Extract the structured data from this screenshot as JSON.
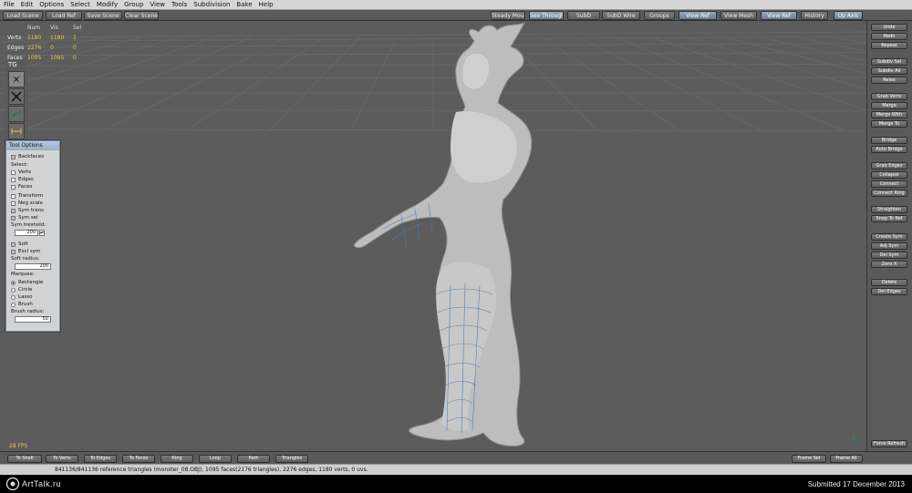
{
  "menu": [
    "File",
    "Edit",
    "Options",
    "Select",
    "Modify",
    "Group",
    "View",
    "Tools",
    "Subdivision",
    "Bake",
    "Help"
  ],
  "toolbar": {
    "left": [
      "Load Scene",
      "Load Ref",
      "Save Scene",
      "Clear Scene"
    ],
    "right": [
      "Steady Mouse",
      "See Through",
      "SubD",
      "SubD Wire",
      "Groups",
      "View Ref",
      "View Mesh",
      "View Ref",
      "History",
      "Up Axis"
    ]
  },
  "stats": {
    "header": [
      "Num",
      "Vis",
      "Sel"
    ],
    "rows": [
      {
        "label": "Verts",
        "num": "1180",
        "vis": "1180",
        "sel": "1"
      },
      {
        "label": "Edges",
        "num": "2276",
        "vis": "0",
        "sel": "0"
      },
      {
        "label": "Faces",
        "num": "1095",
        "vis": "1095",
        "sel": "0"
      }
    ]
  },
  "tool_group": "TG",
  "tool_icons": [
    "move-tool-icon",
    "transform-tool-icon",
    "curve-tool-icon",
    "measure-tool-icon"
  ],
  "tool_options": {
    "title": "Tool Options",
    "backfaces": "Backfaces",
    "select_label": "Select:",
    "verts": "Verts",
    "edges": "Edges",
    "faces": "Faces",
    "transform": "Transform",
    "neg_scale": "Neg scale",
    "sym_trans": "Sym trans",
    "sym_sel": "Sym sel",
    "sym_threshold_label": "Sym treshold:",
    "sym_threshold": "200",
    "soft": "Soft",
    "excl_sym": "Excl sym",
    "soft_radius_label": "Soft radius:",
    "soft_radius": "200",
    "marquee_label": "Marquee:",
    "rectangle": "Rectangle",
    "circle": "Circle",
    "lasso": "Lasso",
    "brush": "Brush",
    "brush_radius_label": "Brush radius:",
    "brush_radius": "50"
  },
  "fps": "28 FPS",
  "right_panel": [
    "Undo",
    "Redo",
    "Repeat",
    "Subdiv Sel",
    "Subdiv All",
    "Relax",
    "Grab Verts",
    "Merge",
    "Merge With",
    "Merge To",
    "Bridge",
    "Auto Bridge",
    "Grab Edges",
    "Collapse",
    "Connect",
    "Connect Ring",
    "Straighten",
    "Snap To Ref",
    "Create Sym",
    "Adj Sym",
    "Del Sym",
    "Zero X",
    "Delete",
    "Del Edges",
    "Force Refresh"
  ],
  "bottom": {
    "left": [
      "To Shell",
      "To Verts",
      "To Edges",
      "To Faces",
      "Ring",
      "Loop",
      "Path",
      "Triangles"
    ],
    "right": [
      "Frame Sel",
      "Frame All"
    ]
  },
  "status_message": "841136/841136 reference triangles (monster_08.OBJ), 1095 faces(2176 triangles), 2276 edges, 1180 verts, 0 uvs.",
  "footer": {
    "logo": "ArtTalk.ru",
    "submitted": "Submitted 17 December 2013"
  }
}
